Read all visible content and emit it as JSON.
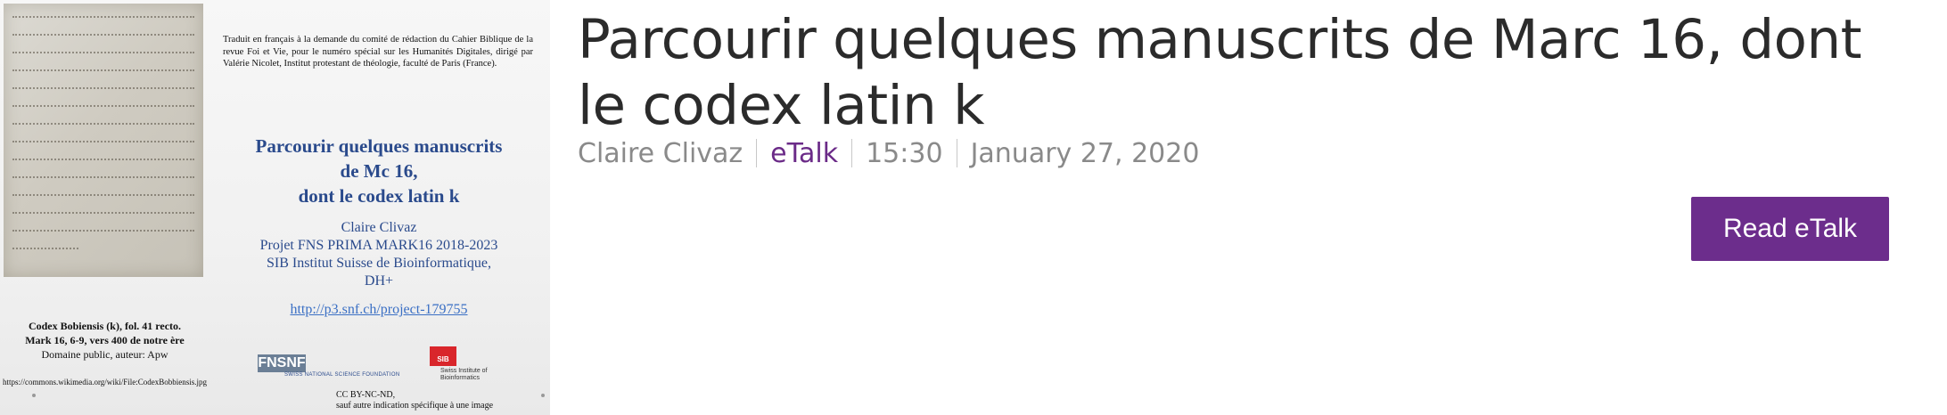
{
  "slide": {
    "caption_top": "Traduit en français à la demande du comité de rédaction du Cahier Biblique de la revue Foi et Vie, pour le numéro spécial sur les Humanités Digitales, dirigé par Valérie Nicolet, Institut protestant de théologie, faculté de Paris (France).",
    "title_line1": "Parcourir quelques manuscrits",
    "title_line2": "de Mc 16,",
    "title_line3": "dont le codex latin k",
    "author": "Claire Clivaz",
    "project": "Projet FNS PRIMA MARK16  2018-2023",
    "institute_line1": "SIB Institut Suisse de Bioinformatique,",
    "institute_line2": "DH+",
    "link": "http://p3.snf.ch/project-179755",
    "codex_line1": "Codex Bobiensis (k), fol. 41 recto.",
    "codex_line2": "Mark 16, 6-9, vers 400 de notre ère",
    "codex_line3": "Domaine public,  auteur:  Apw",
    "codex_url": "https://commons.wikimedia.org/wiki/File:CodexBobbiensis.jpg",
    "fns_logo": "FNSNF",
    "fns_sub": "SWISS NATIONAL SCIENCE FOUNDATION",
    "sib_logo": "SIB",
    "sib_sub": "Swiss Institute of Bioinformatics",
    "license_line1": "CC BY-NC-ND,",
    "license_line2": "sauf autre indication spécifique à une image"
  },
  "main": {
    "title": "Parcourir quelques manuscrits de Marc 16, dont le codex latin k",
    "author": "Claire Clivaz",
    "type": "eTalk",
    "duration": "15:30",
    "date": "January 27, 2020",
    "read_button": "Read eTalk"
  },
  "colors": {
    "accent": "#6c2d8c",
    "slide_blue": "#2a4a8c",
    "meta_gray": "#8a8a8a"
  }
}
